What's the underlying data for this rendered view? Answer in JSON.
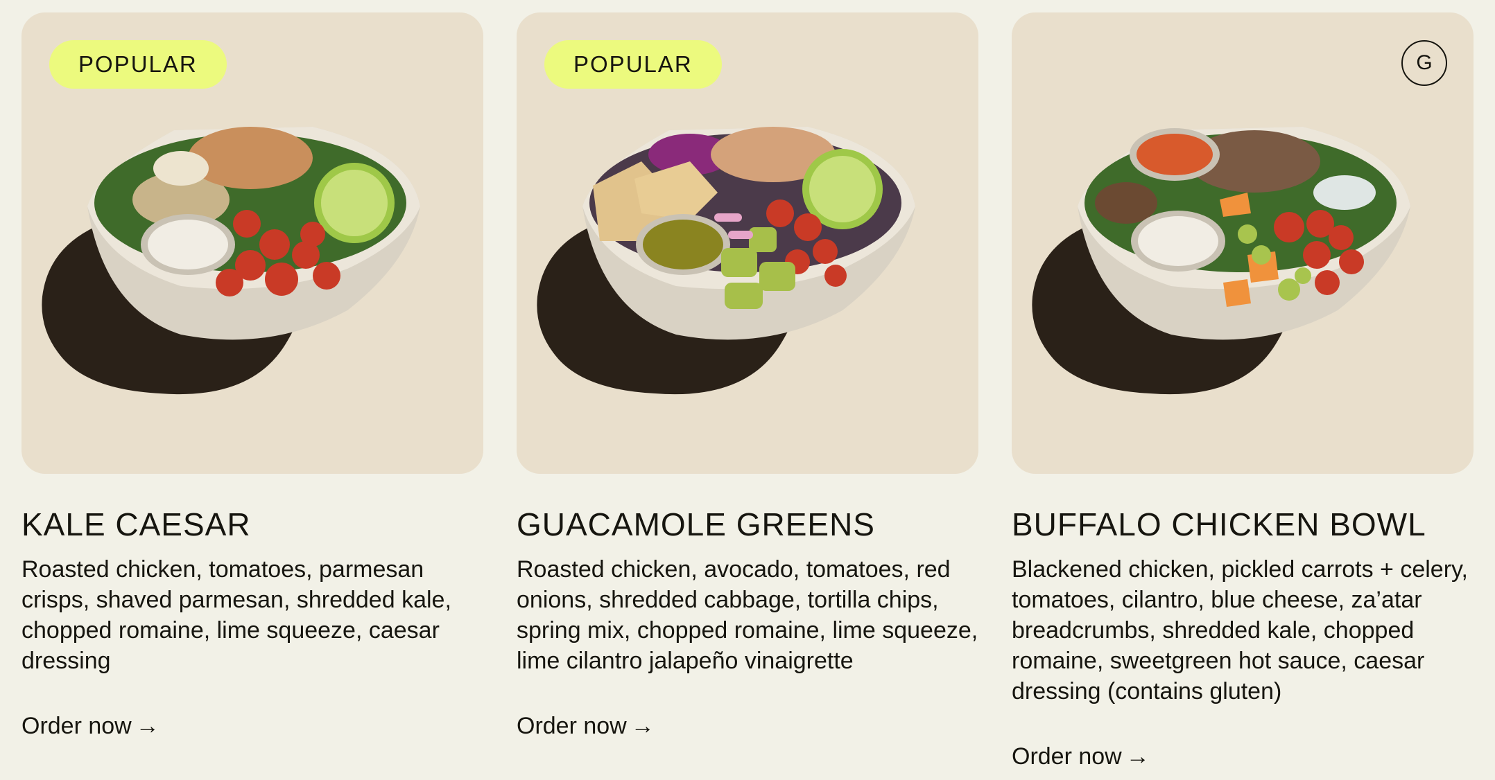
{
  "cards": [
    {
      "badge": "POPULAR",
      "title": "KALE CAESAR",
      "description": "Roasted chicken, tomatoes, parmesan crisps, shaved parmesan, shredded kale, chopped romaine, lime squeeze, caesar dressing",
      "cta": "Order now",
      "cta_icon": "→"
    },
    {
      "badge": "POPULAR",
      "title": "GUACAMOLE GREENS",
      "description": "Roasted chicken, avocado, tomatoes, red onions, shredded cabbage, tortilla chips, spring mix, chopped romaine, lime squeeze, lime cilantro jalapeño vinaigrette",
      "cta": "Order now",
      "cta_icon": "→"
    },
    {
      "diet_badge": "G",
      "title": "BUFFALO CHICKEN BOWL",
      "description": "Blackened chicken, pickled carrots + celery, tomatoes, cilantro, blue cheese, za’atar breadcrumbs, shredded kale, chopped romaine, sweetgreen hot sauce, caesar dressing (contains gluten)",
      "cta": "Order now",
      "cta_icon": "→"
    }
  ],
  "colors": {
    "page_background": "#f2f1e7",
    "tile_background": "#e9dfcc",
    "badge_background": "#ecfa7e",
    "text": "#16150f"
  }
}
